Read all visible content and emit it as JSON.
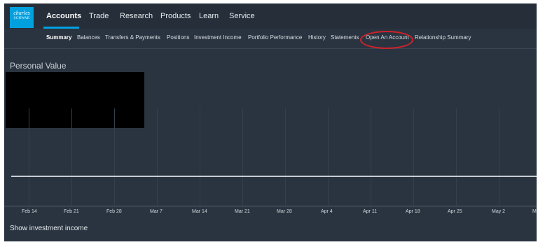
{
  "logo": {
    "line1": "charles",
    "line2": "SCHWAB"
  },
  "top_nav": [
    "Accounts",
    "Trade",
    "Research",
    "Products",
    "Learn",
    "Service"
  ],
  "sub_nav": [
    "Summary",
    "Balances",
    "Transfers & Payments",
    "Positions",
    "Investment Income",
    "Portfolio Performance",
    "History",
    "Statements",
    "Open An Account",
    "Relationship Summary"
  ],
  "main": {
    "title": "Personal Value",
    "show_income": "Show investment income"
  },
  "chart_data": {
    "type": "line",
    "x": [
      "Feb 14",
      "Feb 21",
      "Feb 28",
      "Mar 7",
      "Mar 14",
      "Mar 21",
      "Mar 28",
      "Apr 4",
      "Apr 11",
      "Apr 18",
      "Apr 25",
      "May 2",
      "M"
    ],
    "series": [],
    "title": "Personal Value",
    "grid": true
  },
  "colors": {
    "background": "#2a3440",
    "accent": "#00a0df",
    "highlight": "#d0222a"
  }
}
